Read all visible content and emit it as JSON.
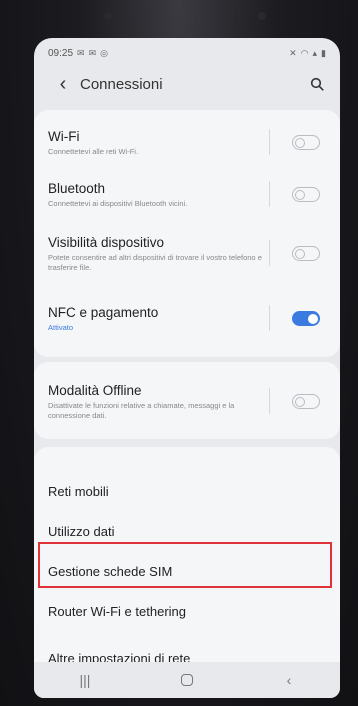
{
  "status_bar": {
    "time": "09:25",
    "left_icons": [
      "notification-icon",
      "notification-icon",
      "target-icon"
    ],
    "right_icons": [
      "mute-icon",
      "wifi-icon",
      "signal-icon",
      "battery-icon"
    ]
  },
  "header": {
    "title": "Connessioni"
  },
  "settings": [
    {
      "title": "Wi-Fi",
      "subtitle": "Connettetevi alle reti Wi-Fi.",
      "toggle": false
    },
    {
      "title": "Bluetooth",
      "subtitle": "Connettetevi ai dispositivi Bluetooth vicini.",
      "toggle": false
    },
    {
      "title": "Visibilità dispositivo",
      "subtitle": "Potete consentire ad altri dispositivi di trovare il vostro telefono e trasferire file.",
      "toggle": false
    },
    {
      "title": "NFC e pagamento",
      "subtitle": "Attivato",
      "toggle": true
    },
    {
      "title": "Modalità Offline",
      "subtitle": "Disattivate le funzioni relative a chiamate, messaggi e la connessione dati.",
      "toggle": false
    }
  ],
  "list_items": [
    "Reti mobili",
    "Utilizzo dati",
    "Gestione schede SIM",
    "Router Wi-Fi e tethering",
    "Altre impostazioni di rete"
  ],
  "colors": {
    "accent": "#3b7be0",
    "highlight": "#e0323a"
  }
}
